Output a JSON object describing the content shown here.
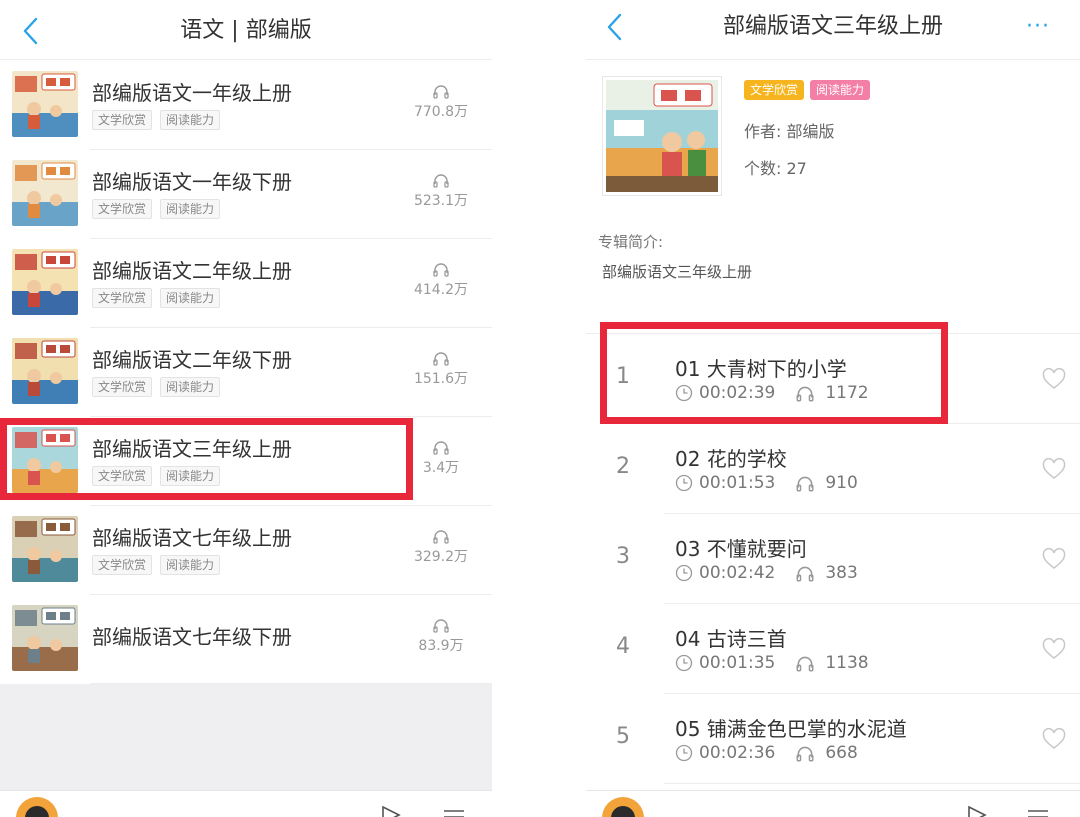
{
  "left": {
    "nav": {
      "title": "语文 | 部编版"
    },
    "books": [
      {
        "title": "部编版语文一年级上册",
        "tags": [
          "文学欣赏",
          "阅读能力"
        ],
        "plays": "770.8万",
        "cover": "cover-grade1-up"
      },
      {
        "title": "部编版语文一年级下册",
        "tags": [
          "文学欣赏",
          "阅读能力"
        ],
        "plays": "523.1万",
        "cover": "cover-grade1-down"
      },
      {
        "title": "部编版语文二年级上册",
        "tags": [
          "文学欣赏",
          "阅读能力"
        ],
        "plays": "414.2万",
        "cover": "cover-grade2-up"
      },
      {
        "title": "部编版语文二年级下册",
        "tags": [
          "文学欣赏",
          "阅读能力"
        ],
        "plays": "151.6万",
        "cover": "cover-grade2-down"
      },
      {
        "title": "部编版语文三年级上册",
        "tags": [
          "文学欣赏",
          "阅读能力"
        ],
        "plays": "3.4万",
        "cover": "cover-grade3-up"
      },
      {
        "title": "部编版语文七年级上册",
        "tags": [
          "文学欣赏",
          "阅读能力"
        ],
        "plays": "329.2万",
        "cover": "cover-grade7-up"
      },
      {
        "title": "部编版语文七年级下册",
        "tags": [],
        "plays": "83.9万",
        "cover": "cover-grade7-down"
      }
    ]
  },
  "right": {
    "nav": {
      "title": "部编版语文三年级上册",
      "more": "···"
    },
    "album": {
      "tags": [
        "文学欣赏",
        "阅读能力"
      ],
      "author": "作者:  部编版",
      "count": "个数:  27",
      "intro_label": "专辑简介:",
      "intro_text": "部编版语文三年级上册"
    },
    "tracks": [
      {
        "index": "1",
        "title": "01 大青树下的小学",
        "duration": "00:02:39",
        "plays": "1172"
      },
      {
        "index": "2",
        "title": "02 花的学校",
        "duration": "00:01:53",
        "plays": "910"
      },
      {
        "index": "3",
        "title": "03 不懂就要问",
        "duration": "00:02:42",
        "plays": "383"
      },
      {
        "index": "4",
        "title": "04 古诗三首",
        "duration": "00:01:35",
        "plays": "1138"
      },
      {
        "index": "5",
        "title": "05 铺满金色巴掌的水泥道",
        "duration": "00:02:36",
        "plays": "668"
      }
    ]
  },
  "colors": {
    "accent": "#29a3e8",
    "highlight": "#e8283a",
    "tag_yellow": "#f6b51e",
    "tag_pink": "#f47fa6"
  }
}
